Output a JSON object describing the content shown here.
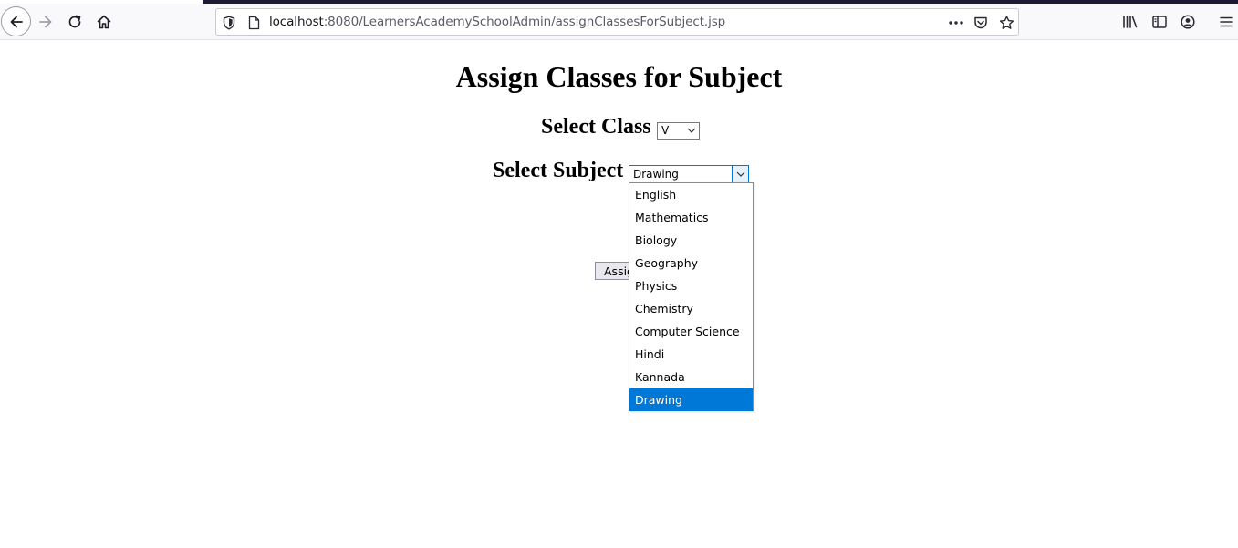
{
  "browser": {
    "url_host": "localhost",
    "url_rest": ":8080/LearnersAcademySchoolAdmin/assignClassesForSubject.jsp",
    "icons": [
      "back-arrow-icon",
      "forward-arrow-icon",
      "reload-icon",
      "home-icon",
      "shield-icon",
      "page-icon",
      "more-actions-icon",
      "pocket-icon",
      "bookmark-star-icon",
      "library-icon",
      "sidebar-icon",
      "account-icon",
      "menu-icon"
    ]
  },
  "page": {
    "title": "Assign Classes for Subject",
    "class_label": "Select Class",
    "class_selected": "V",
    "subject_label": "Select Subject",
    "subject_selected": "Drawing",
    "assign_button": "Assign"
  },
  "subject_options": [
    {
      "label": "English",
      "selected": false
    },
    {
      "label": "Mathematics",
      "selected": false
    },
    {
      "label": "Biology",
      "selected": false
    },
    {
      "label": "Geography",
      "selected": false
    },
    {
      "label": "Physics",
      "selected": false
    },
    {
      "label": "Chemistry",
      "selected": false
    },
    {
      "label": "Computer Science",
      "selected": false
    },
    {
      "label": "Hindi",
      "selected": false
    },
    {
      "label": "Kannada",
      "selected": false
    },
    {
      "label": "Drawing",
      "selected": true
    }
  ],
  "colors": {
    "selection": "#0078d7",
    "chrome_background": "#f9f9fb",
    "top_strip": "#1c1b33"
  }
}
